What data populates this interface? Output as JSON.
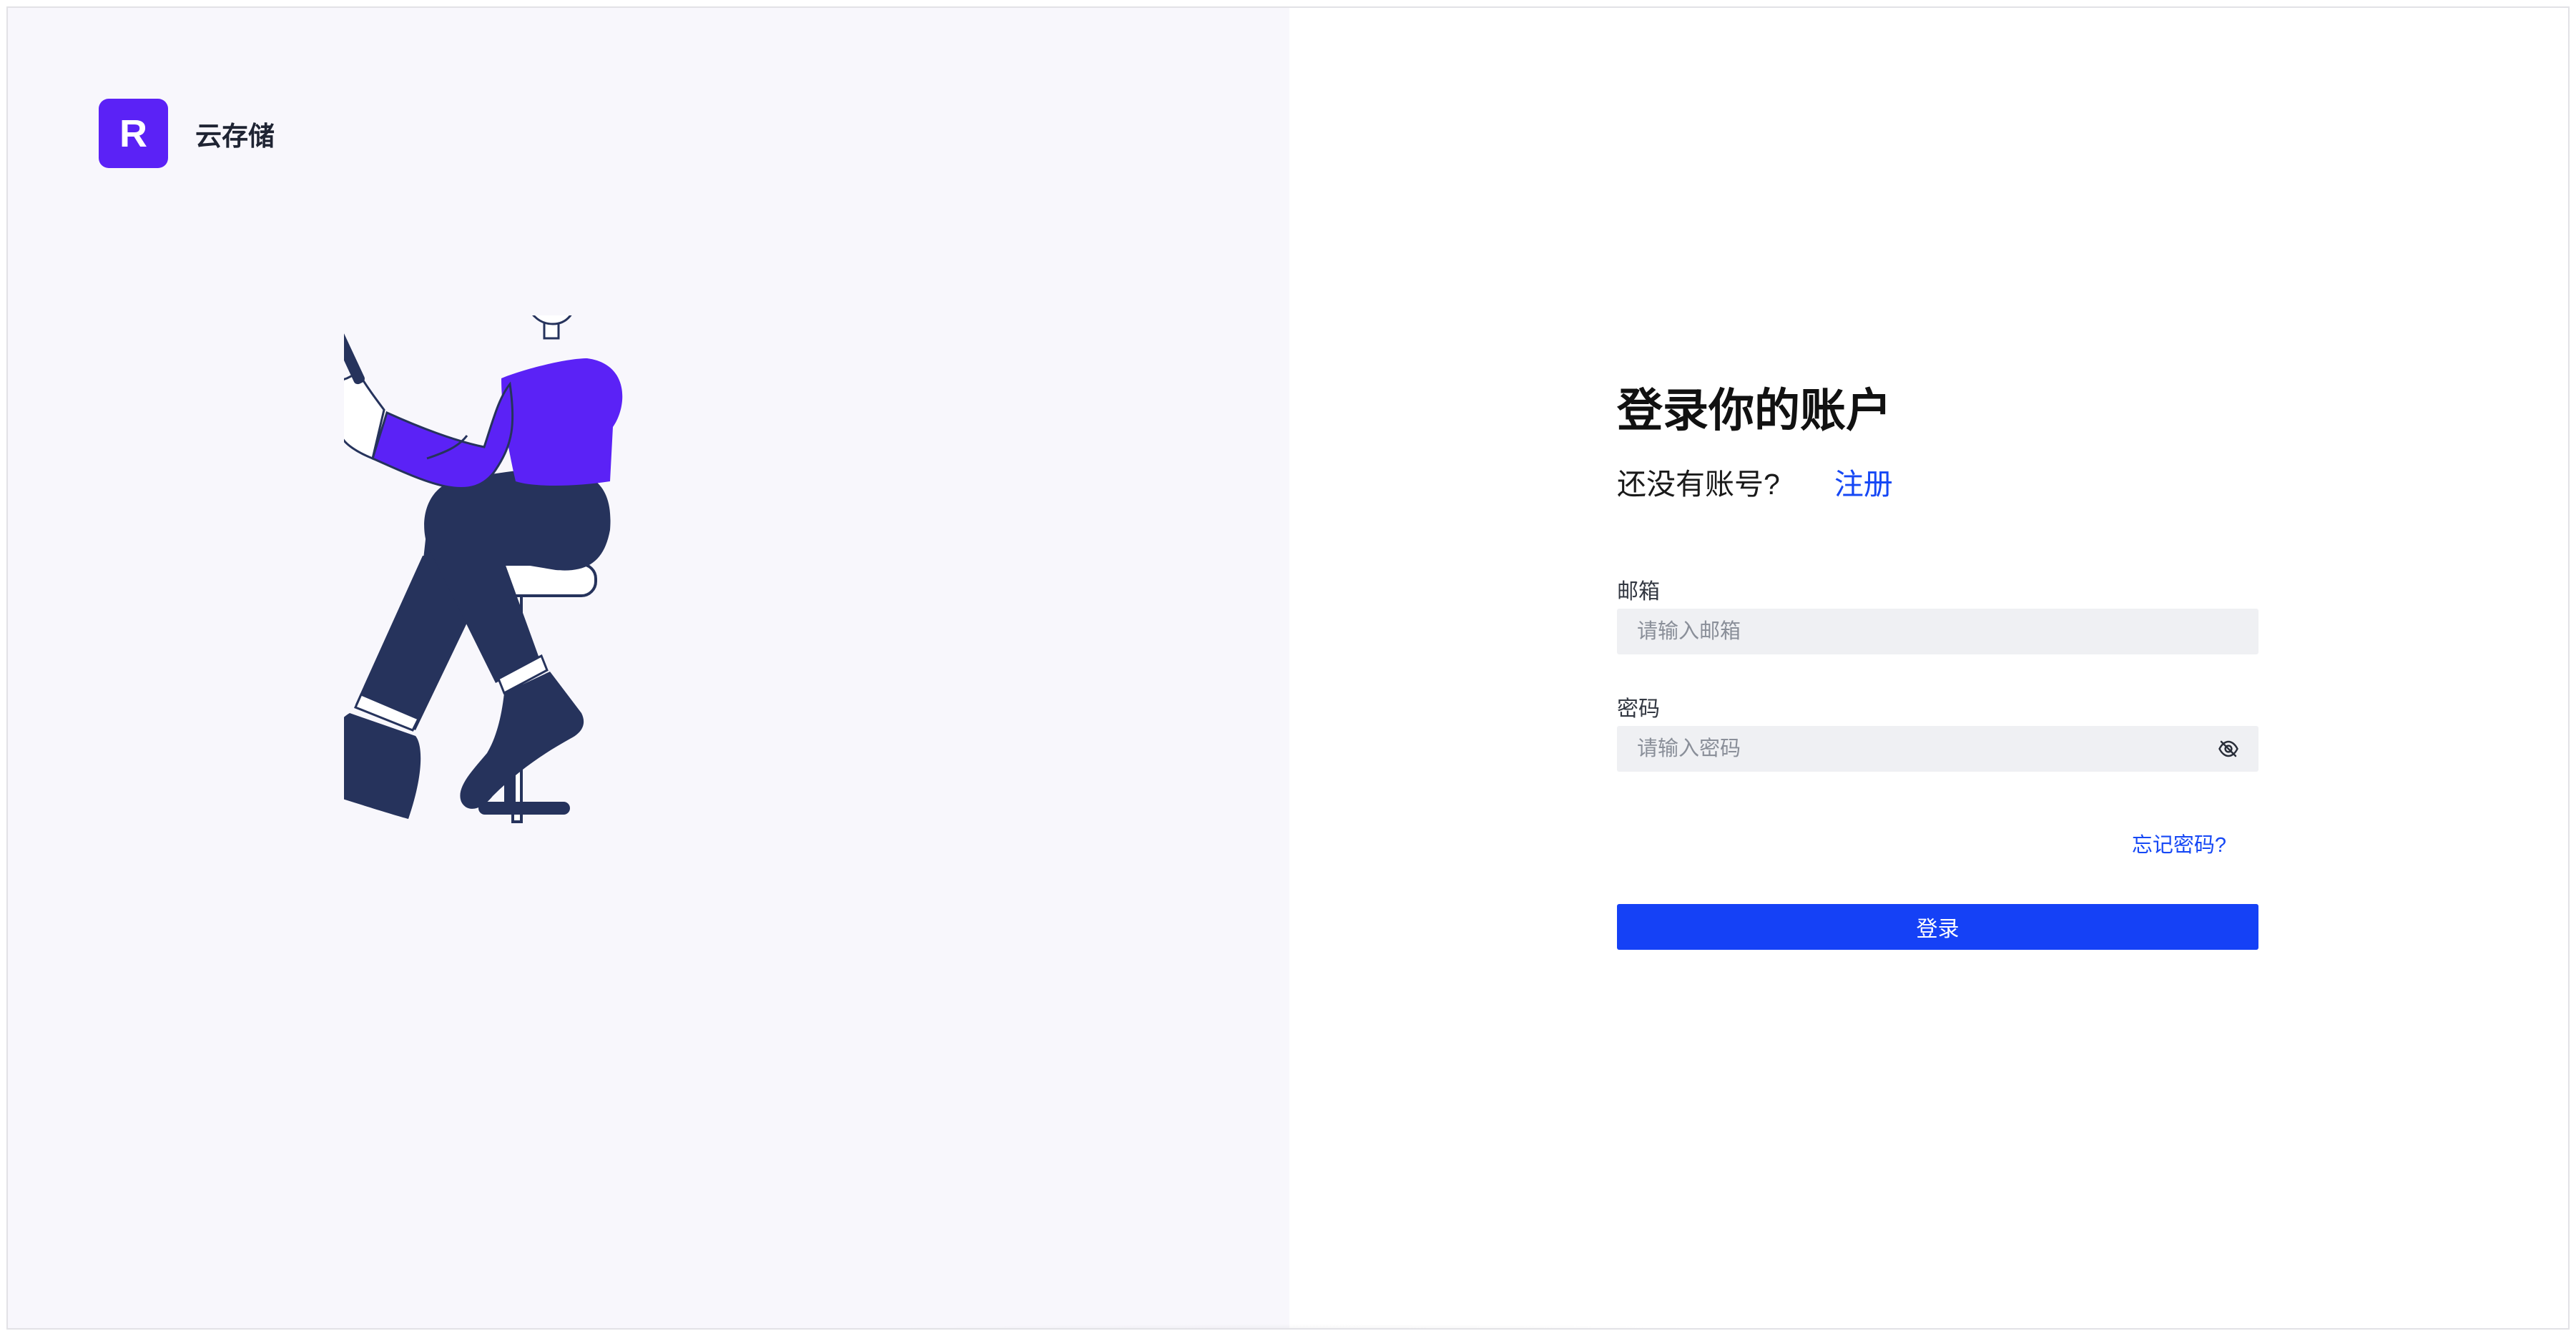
{
  "brand": {
    "logo_letter": "R",
    "name": "云存储",
    "accent_color": "#5b22f6"
  },
  "login": {
    "title": "登录你的账户",
    "no_account_text": "还没有账号?",
    "register_link": "注册",
    "email": {
      "label": "邮箱",
      "placeholder": "请输入邮箱",
      "value": ""
    },
    "password": {
      "label": "密码",
      "placeholder": "请输入密码",
      "value": "",
      "toggle_icon": "eye-off-icon"
    },
    "forgot_password": "忘记密码?",
    "submit_label": "登录",
    "primary_color": "#1541f6"
  },
  "illustration": {
    "name": "person-sitting-with-phone-illustration"
  }
}
